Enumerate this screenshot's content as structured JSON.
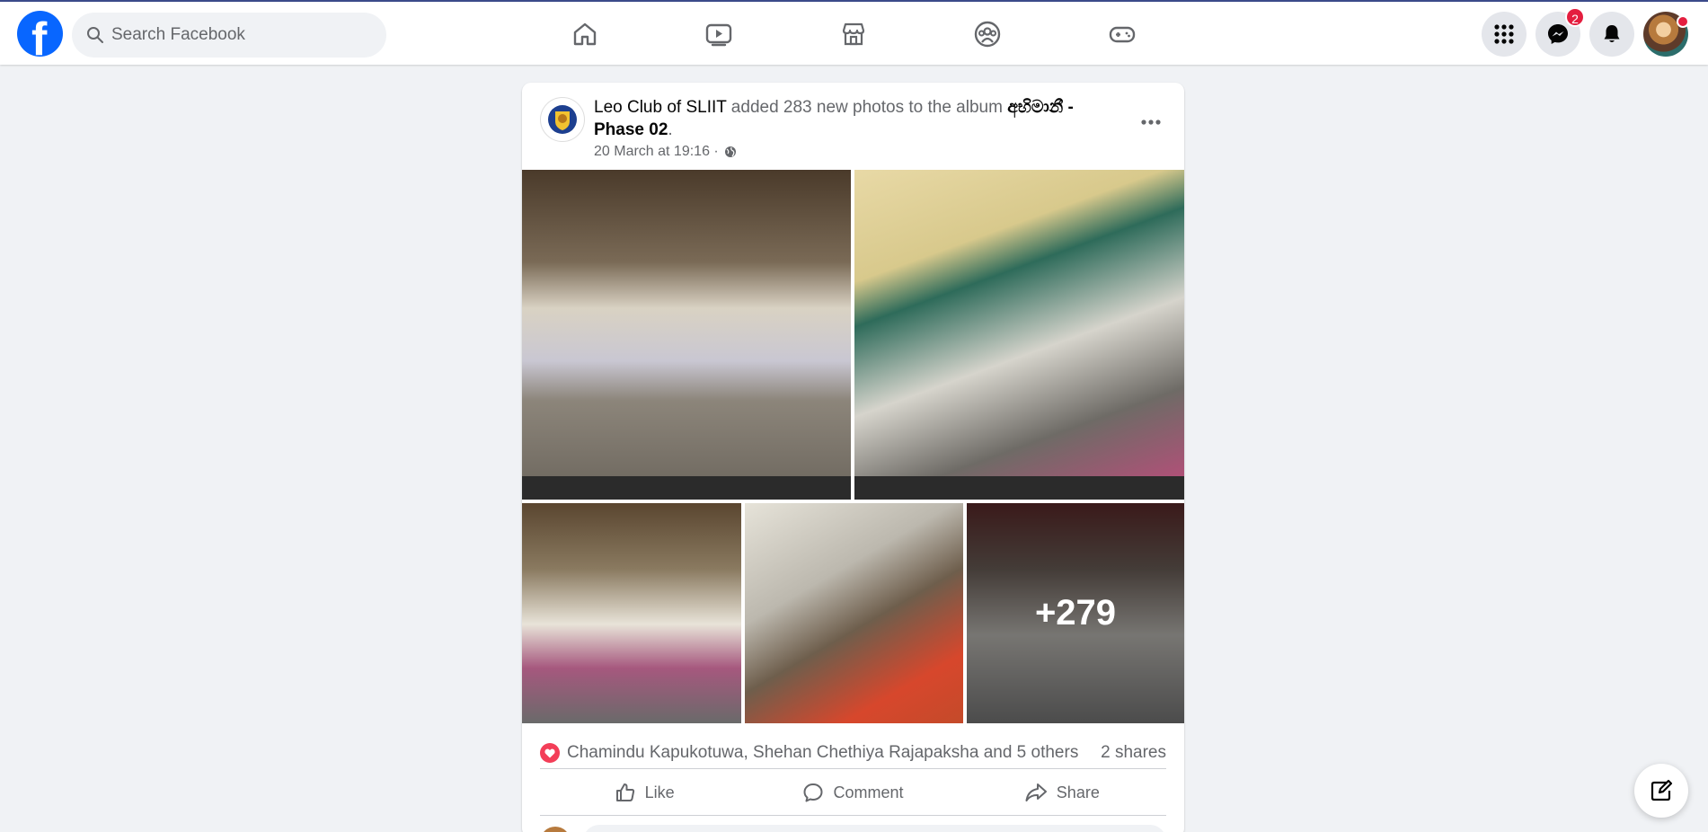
{
  "header": {
    "logo": "f",
    "search_placeholder": "Search Facebook",
    "nav_icons": [
      "home-icon",
      "video-icon",
      "marketplace-icon",
      "groups-icon",
      "gaming-icon"
    ],
    "messenger_badge": "2"
  },
  "post": {
    "author": "Leo Club of SLIIT",
    "action_text": " added 283 new photos to the album ",
    "album_name": "අභිමානී - Phase 02",
    "trailing": ".",
    "timestamp": "20 March at 19:16 ·",
    "more_count": "+279",
    "reactions_text": "Chamindu Kapukotuwa, Shehan Chethiya Rajapaksha and 5 others",
    "shares": "2 shares",
    "actions": {
      "like": "Like",
      "comment": "Comment",
      "share": "Share"
    }
  },
  "colors": {
    "brand": "#0866ff",
    "badge": "#e41e3f",
    "love": "#f33e58"
  }
}
